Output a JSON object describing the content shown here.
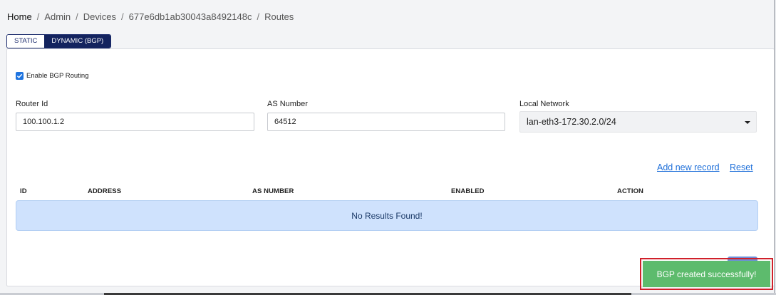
{
  "breadcrumb": [
    "Home",
    "Admin",
    "Devices",
    "677e6db1ab30043a8492148c",
    "Routes"
  ],
  "tabs": [
    {
      "label": "STATIC",
      "active": false
    },
    {
      "label": "DYNAMIC (BGP)",
      "active": true
    }
  ],
  "bgp": {
    "enable_label": "Enable BGP Routing",
    "enabled": true,
    "router_id_label": "Router Id",
    "router_id_value": "100.100.1.2",
    "as_number_label": "AS Number",
    "as_number_value": "64512",
    "local_network_label": "Local Network",
    "local_network_value": "lan-eth3-172.30.2.0/24"
  },
  "actions": {
    "add_label": "Add new record",
    "reset_label": "Reset"
  },
  "table": {
    "headers": [
      "ID",
      "ADDRESS",
      "AS NUMBER",
      "ENABLED",
      "ACTION"
    ],
    "empty_message": "No Results Found!"
  },
  "toast": {
    "message": "BGP created successfully!"
  },
  "colors": {
    "accent": "#13235e",
    "link": "#1e6fd9",
    "checkbox": "#1e74e0",
    "info_bg": "#cfe2fd",
    "toast_bg": "#5dbb6d",
    "highlight_border": "#d0202a"
  }
}
